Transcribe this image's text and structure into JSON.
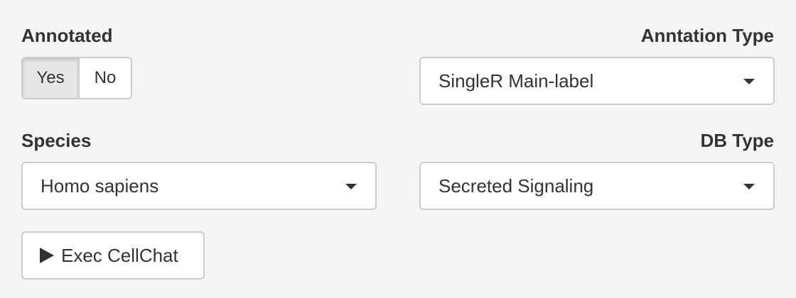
{
  "annotated": {
    "label": "Annotated",
    "options": [
      {
        "label": "Yes",
        "selected": true
      },
      {
        "label": "No",
        "selected": false
      }
    ]
  },
  "annotation_type": {
    "label": "Anntation Type",
    "value": "SingleR Main-label"
  },
  "species": {
    "label": "Species",
    "value": "Homo sapiens"
  },
  "db_type": {
    "label": "DB Type",
    "value": "Secreted Signaling"
  },
  "exec_button": {
    "label": "Exec CellChat",
    "icon": "play-icon"
  }
}
